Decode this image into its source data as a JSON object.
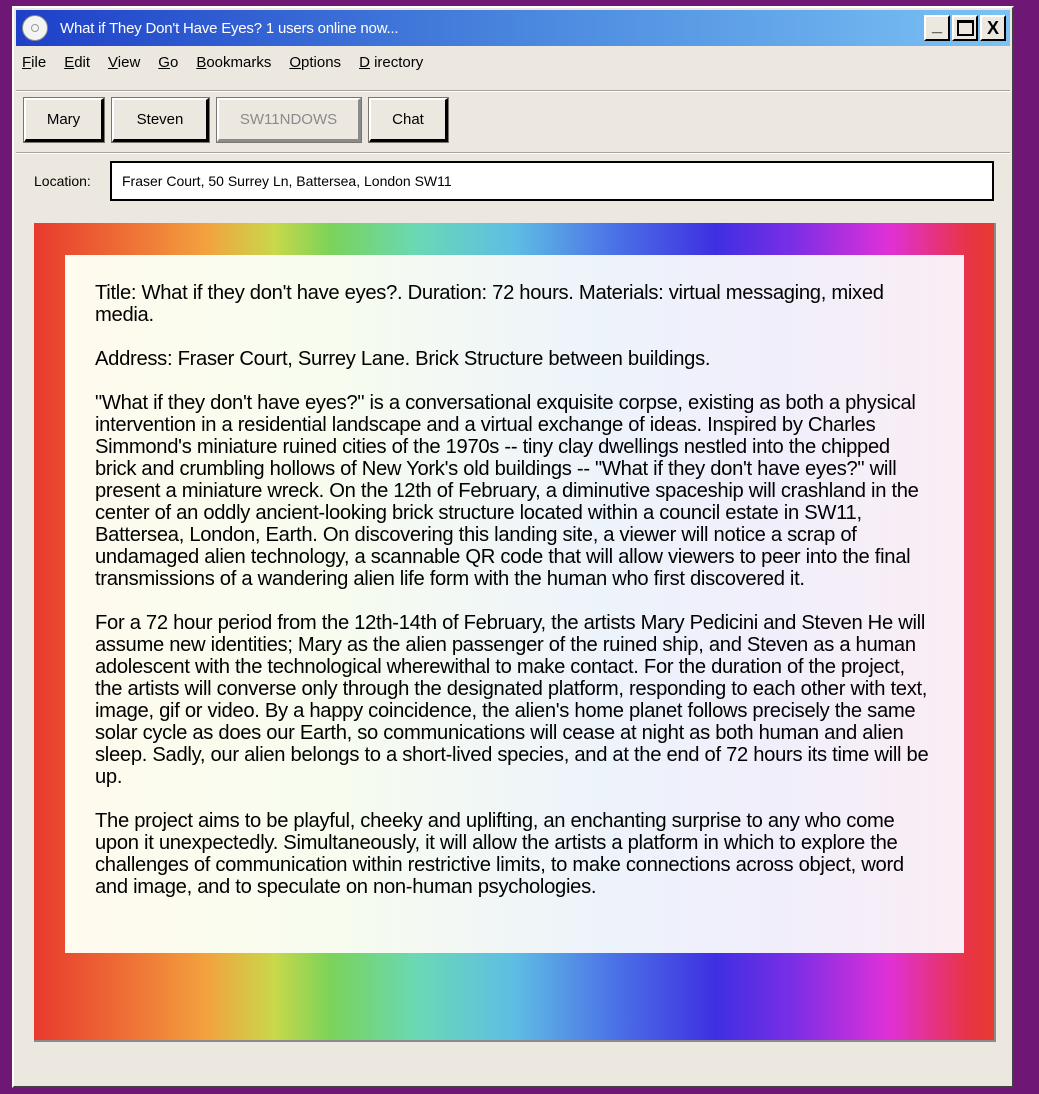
{
  "window": {
    "title": "What if They Don't Have Eyes? 1 users online now...",
    "controls": {
      "minimize": "_",
      "maximize": "□",
      "close": "X"
    }
  },
  "menu": [
    {
      "accel": "F",
      "rest": "ile"
    },
    {
      "accel": "E",
      "rest": "dit"
    },
    {
      "accel": "V",
      "rest": "iew"
    },
    {
      "accel": "G",
      "rest": "o"
    },
    {
      "accel": "B",
      "rest": "ookmarks"
    },
    {
      "accel": "O",
      "rest": "ptions"
    },
    {
      "accel": "D",
      "rest": "irectory"
    }
  ],
  "toolbar": {
    "mary": "Mary",
    "steven": "Steven",
    "sw11ndows": "SW11NDOWS",
    "chat": "Chat"
  },
  "location": {
    "label": "Location:",
    "value": "Fraser Court, 50 Surrey Ln, Battersea, London SW11"
  },
  "content": {
    "p1": "Title: What if they don't have eyes?. Duration: 72 hours. Materials: virtual messaging, mixed media.",
    "p2": "Address: Fraser Court, Surrey Lane. Brick Structure between buildings.",
    "p3": "\"What if they don't have eyes?\" is a conversational exquisite corpse, existing as both a physical intervention in a residential landscape and a virtual exchange of ideas. Inspired by Charles Simmond's miniature ruined cities of the 1970s -- tiny clay dwellings nestled into the chipped brick and crumbling hollows of New York's old buildings -- \"What if they don't have eyes?\" will present a miniature wreck. On the 12th of February, a diminutive spaceship will crashland in the center of an oddly ancient-looking brick structure located within a council estate in SW11, Battersea, London, Earth. On discovering this landing site, a viewer will notice a scrap of undamaged alien technology, a scannable QR code that will allow viewers to peer into the final transmissions of a wandering alien life form with the human who first discovered it.",
    "p4": "For a 72 hour period from the 12th-14th of February, the artists Mary Pedicini and Steven He will assume new identities; Mary as the alien passenger of the ruined ship, and Steven as a human adolescent with the technological wherewithal to make contact. For the duration of the project, the artists will converse only through the designated platform, responding to each other with text, image, gif or video. By a happy coincidence, the alien's home planet follows precisely the same solar cycle as does our Earth, so communications will cease at night as both human and alien sleep. Sadly, our alien belongs to a short-lived species, and at the end of 72 hours its time will be up.",
    "p5": "The project aims to be playful, cheeky and uplifting, an enchanting surprise to any who come upon it unexpectedly. Simultaneously, it will allow the artists a platform in which to explore the challenges of communication within restrictive limits, to make connections across object, word and image, and to speculate on non-human psychologies."
  },
  "colors": {
    "desktop": "#6f1775",
    "titlebar_start": "#1e40c8",
    "titlebar_end": "#7cc2f4",
    "chrome": "#ece8e0"
  }
}
